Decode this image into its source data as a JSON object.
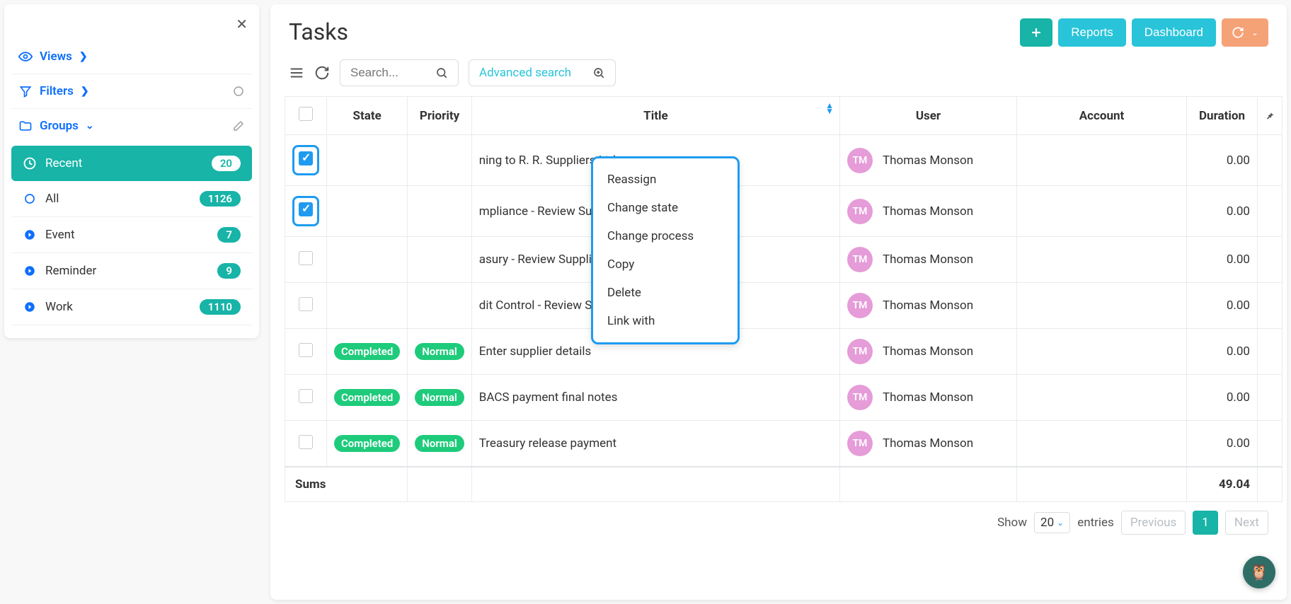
{
  "sidebar": {
    "views_label": "Views",
    "filters_label": "Filters",
    "groups_label": "Groups",
    "items": [
      {
        "label": "Recent",
        "count": "20",
        "icon": "clock",
        "active": true
      },
      {
        "label": "All",
        "count": "1126",
        "icon": "circle",
        "active": false
      },
      {
        "label": "Event",
        "count": "7",
        "icon": "arrow",
        "active": false
      },
      {
        "label": "Reminder",
        "count": "9",
        "icon": "arrow",
        "active": false
      },
      {
        "label": "Work",
        "count": "1110",
        "icon": "arrow",
        "active": false
      }
    ]
  },
  "header": {
    "title": "Tasks",
    "buttons": {
      "reports": "Reports",
      "dashboard": "Dashboard"
    }
  },
  "toolbar": {
    "search_placeholder": "Search...",
    "advanced_label": "Advanced search"
  },
  "context_menu": [
    "Reassign",
    "Change state",
    "Change process",
    "Copy",
    "Delete",
    "Link with"
  ],
  "table": {
    "headers": {
      "state": "State",
      "priority": "Priority",
      "title": "Title",
      "user": "User",
      "account": "Account",
      "duration": "Duration"
    },
    "rows": [
      {
        "checked": true,
        "hl": true,
        "state": "",
        "priority": "",
        "title": "ning to R. R. Suppliers Ltd",
        "user": "Thomas Monson",
        "initials": "TM",
        "account": "",
        "duration": "0.00"
      },
      {
        "checked": true,
        "hl": true,
        "state": "",
        "priority": "",
        "title": "mpliance - Review Supplier Details",
        "user": "Thomas Monson",
        "initials": "TM",
        "account": "",
        "duration": "0.00"
      },
      {
        "checked": false,
        "hl": false,
        "state": "",
        "priority": "",
        "title": "asury - Review Supplier Details",
        "user": "Thomas Monson",
        "initials": "TM",
        "account": "",
        "duration": "0.00"
      },
      {
        "checked": false,
        "hl": false,
        "state": "",
        "priority": "",
        "title": "dit Control - Review Supplier Details",
        "user": "Thomas Monson",
        "initials": "TM",
        "account": "",
        "duration": "0.00"
      },
      {
        "checked": false,
        "hl": false,
        "state": "Completed",
        "priority": "Normal",
        "title": "Enter supplier details",
        "user": "Thomas Monson",
        "initials": "TM",
        "account": "",
        "duration": "0.00"
      },
      {
        "checked": false,
        "hl": false,
        "state": "Completed",
        "priority": "Normal",
        "title": "BACS payment final notes",
        "user": "Thomas Monson",
        "initials": "TM",
        "account": "",
        "duration": "0.00"
      },
      {
        "checked": false,
        "hl": false,
        "state": "Completed",
        "priority": "Normal",
        "title": "Treasury release payment",
        "user": "Thomas Monson",
        "initials": "TM",
        "account": "",
        "duration": "0.00"
      }
    ],
    "sums_label": "Sums",
    "sums_duration": "49.04"
  },
  "footer": {
    "show": "Show",
    "page_size": "20",
    "entries": "entries",
    "previous": "Previous",
    "page": "1",
    "next": "Next"
  }
}
